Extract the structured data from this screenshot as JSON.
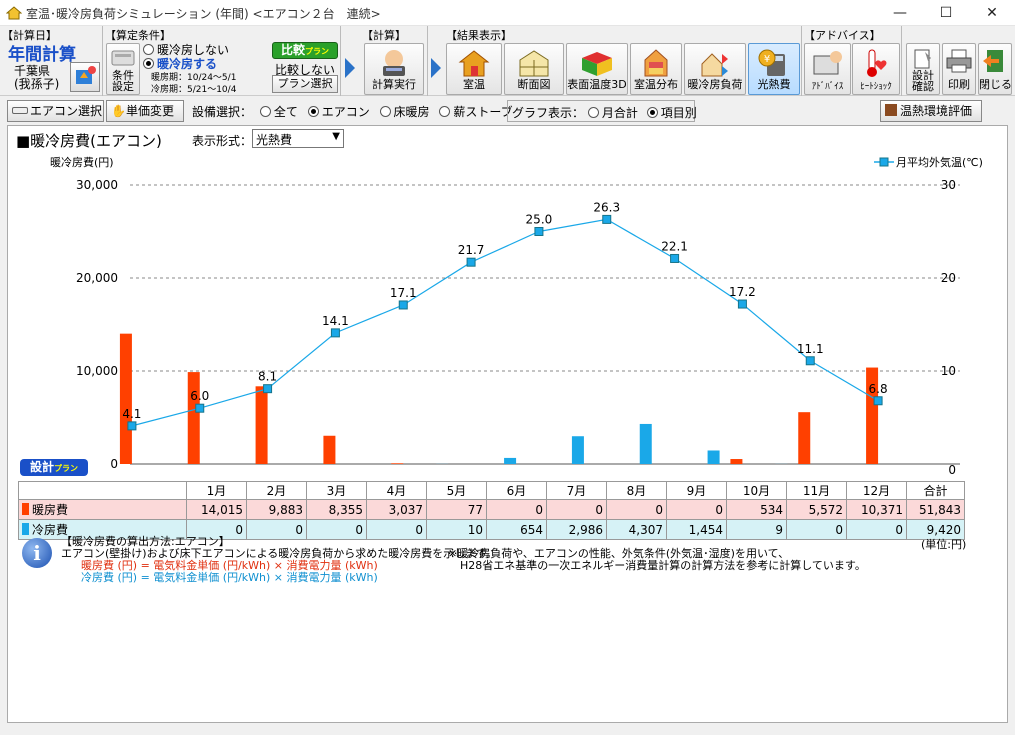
{
  "window": {
    "title": "室温･暖冷房負荷シミュレーション (年間) <エアコン２台　連続>",
    "min": "—",
    "max": "☐",
    "close": "✕"
  },
  "toolbar": {
    "calc_day": {
      "group": "【計算日】",
      "mode": "年間計算",
      "location": "千葉県\n(我孫子)"
    },
    "conditions": {
      "group": "【算定条件】",
      "opt1": "暖冷房しない",
      "opt2": "暖冷房する",
      "heat_period": "暖房期：10/24～5/1",
      "cool_period": "冷房期：5/21～10/4",
      "btn": "条件\n設定",
      "compare_badge": "比較",
      "compare_badge_sub": "プラン",
      "compare_none": "比較しない",
      "plan_select": "プラン選択"
    },
    "calc": {
      "group": "【計算】",
      "run": "計算実行"
    },
    "results": {
      "group": "【結果表示】",
      "items": [
        "室温",
        "断面図",
        "表面温度3D",
        "室温分布",
        "暖冷房負荷",
        "光熱費"
      ]
    },
    "advice": {
      "group": "【アドバイス】",
      "items": [
        "ｱﾄﾞﾊﾞｲｽ",
        "ﾋｰﾄｼｮｯｸ"
      ]
    },
    "misc": {
      "items": [
        "設計\n確認",
        "印刷",
        "閉じる"
      ]
    }
  },
  "row2": {
    "aircon_select": "エアコン選択",
    "unit_price": "単価変更",
    "equip_label": "設備選択：",
    "equip_opts": [
      "全て",
      "エアコン",
      "床暖房",
      "薪ストーブ"
    ],
    "graph_label": "グラフ表示：",
    "graph_opts": [
      "月合計",
      "項目別"
    ],
    "thermal_eval": "温熱環境評価"
  },
  "panel": {
    "title": "■暖冷房費(エアコン)",
    "format_label": "表示形式：",
    "format_value": "光熱費",
    "plan_badge": "設計",
    "plan_badge_sub": "プラン"
  },
  "chart_data": {
    "type": "bar",
    "ylabel": "暖冷房費(円)",
    "y2label": "月平均外気温(℃)",
    "ylim": [
      0,
      30000
    ],
    "y2lim": [
      0,
      30
    ],
    "yticks": [
      "0",
      "10,000",
      "20,000",
      "30,000"
    ],
    "y2ticks": [
      "0",
      "10",
      "20",
      "30"
    ],
    "categories": [
      "1月",
      "2月",
      "3月",
      "4月",
      "5月",
      "6月",
      "7月",
      "8月",
      "9月",
      "10月",
      "11月",
      "12月"
    ],
    "series": [
      {
        "name": "暖房費",
        "color": "#ff4000",
        "values": [
          14015,
          9883,
          8355,
          3037,
          77,
          0,
          0,
          0,
          0,
          534,
          5572,
          10371
        ]
      },
      {
        "name": "冷房費",
        "color": "#1aa8e8",
        "values": [
          0,
          0,
          0,
          0,
          10,
          654,
          2986,
          4307,
          1454,
          9,
          0,
          0
        ]
      }
    ],
    "temperature": {
      "name": "月平均外気温(℃)",
      "color": "#1aa8e8",
      "values": [
        4.1,
        6.0,
        8.1,
        14.1,
        17.1,
        21.7,
        25.0,
        26.3,
        22.1,
        17.2,
        11.1,
        6.8
      ],
      "labels": [
        "4.1",
        "6.0",
        "8.1",
        "14.1",
        "17.1",
        "21.7",
        "25.0",
        "26.3",
        "22.1",
        "17.2",
        "11.1",
        "6.8"
      ]
    }
  },
  "table": {
    "total_label": "合計",
    "heat_label": "暖房費",
    "cool_label": "冷房費",
    "heat": [
      "14,015",
      "9,883",
      "8,355",
      "3,037",
      "77",
      "0",
      "0",
      "0",
      "0",
      "534",
      "5,572",
      "10,371",
      "51,843"
    ],
    "cool": [
      "0",
      "0",
      "0",
      "0",
      "10",
      "654",
      "2,986",
      "4,307",
      "1,454",
      "9",
      "0",
      "0",
      "9,420"
    ],
    "unit": "(単位:円)"
  },
  "info": {
    "title": "【暖冷房費の算出方法:エアコン】",
    "line1": "エアコン(壁掛け)および床下エアコンによる暖冷房負荷から求めた暖冷房費を示します。",
    "heat_formula": "暖房費 (円) = 電気料金単価 (円/kWh) × 消費電力量 (kWh)",
    "cool_formula": "冷房費 (円) = 電気料金単価 (円/kWh) × 消費電力量 (kWh)",
    "note1": "※暖冷房負荷や、エアコンの性能、外気条件(外気温･湿度)を用いて、",
    "note2": "H28省エネ基準の一次エネルギー消費量計算の計算方法を参考に計算しています。"
  }
}
